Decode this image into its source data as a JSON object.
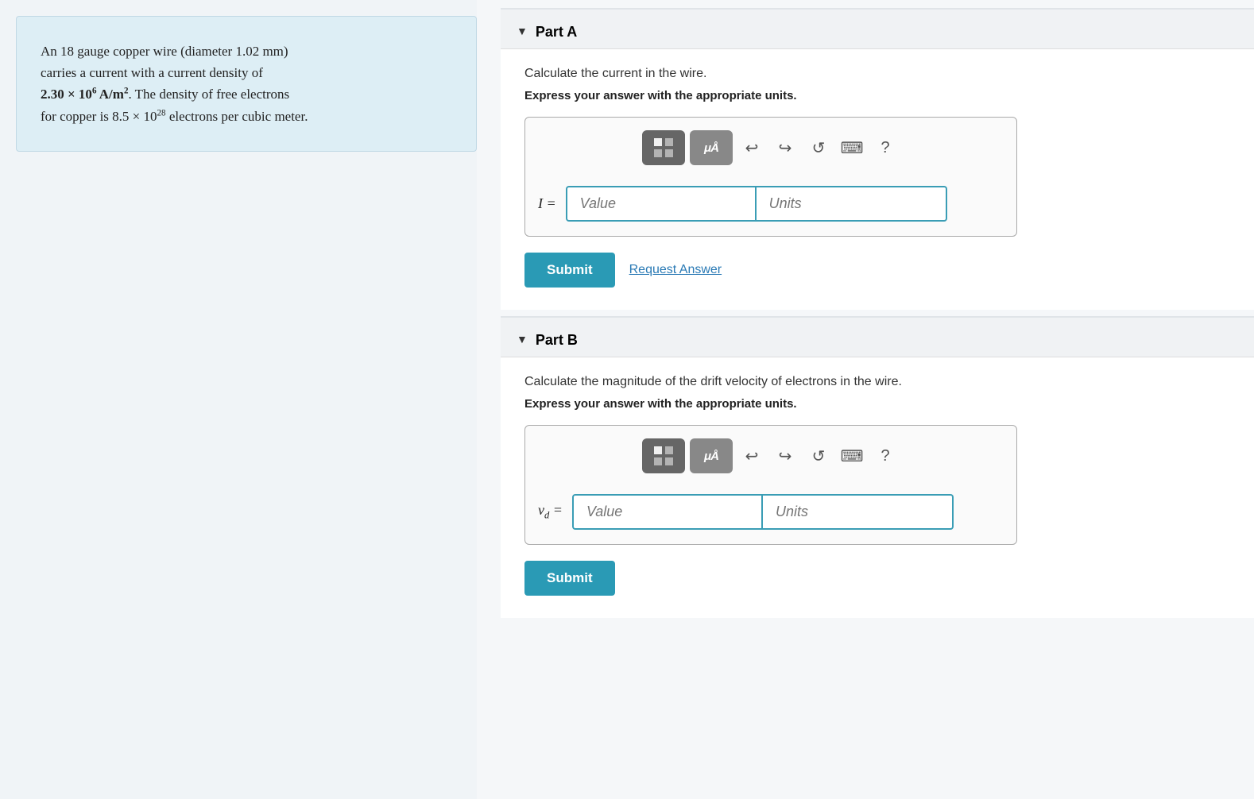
{
  "left_panel": {
    "text_line1": "An 18 gauge copper wire (diameter 1.02 mm)",
    "text_line2": "carries a current with a current density of",
    "text_line3_pre": "2.30 × 10",
    "text_line3_exp": "6",
    "text_line3_mid": " A/m",
    "text_line3_exp2": "2",
    "text_line3_post": ". The density of free electrons",
    "text_line4_pre": "for copper is 8.5 × 10",
    "text_line4_exp": "28",
    "text_line4_post": " electrons per cubic meter."
  },
  "part_a": {
    "header": "Part A",
    "description": "Calculate the current in the wire.",
    "express_note": "Express your answer with the appropriate units.",
    "input_label": "I =",
    "value_placeholder": "Value",
    "units_placeholder": "Units",
    "submit_label": "Submit",
    "request_label": "Request Answer"
  },
  "part_b": {
    "header": "Part B",
    "description": "Calculate the magnitude of the drift velocity of electrons in the wire.",
    "express_note": "Express your answer with the appropriate units.",
    "input_label_pre": "v",
    "input_label_sub": "d",
    "input_label_post": " =",
    "value_placeholder": "Value",
    "units_placeholder": "Units",
    "submit_label": "Submit"
  },
  "toolbar": {
    "undo_label": "↩",
    "redo_label": "↪",
    "reset_label": "↺",
    "keyboard_label": "⌨",
    "help_label": "?"
  }
}
